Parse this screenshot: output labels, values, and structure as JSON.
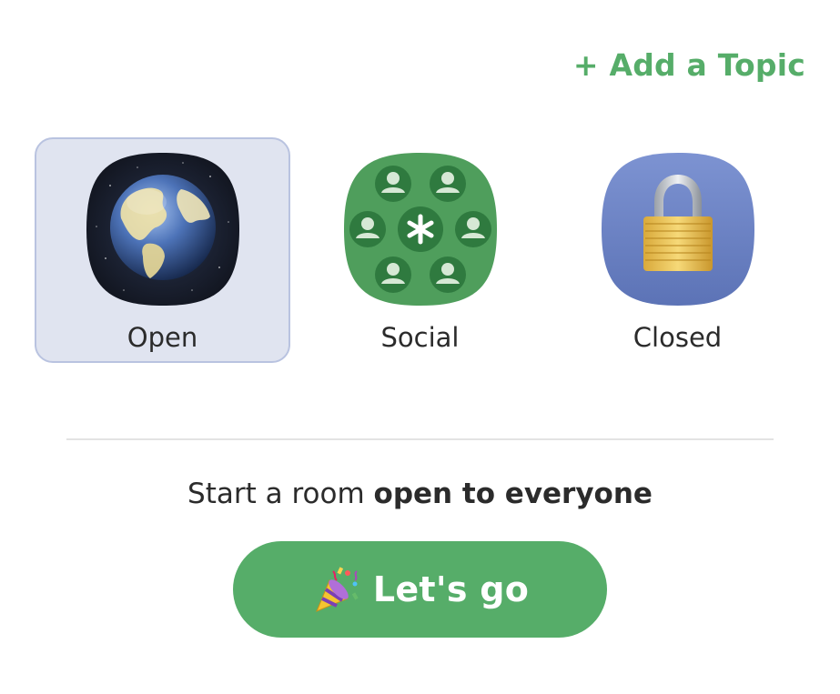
{
  "header": {
    "add_topic_label": "+ Add a Topic"
  },
  "room_types": [
    {
      "label": "Open",
      "icon": "globe-icon",
      "selected": true
    },
    {
      "label": "Social",
      "icon": "social-group-icon",
      "selected": false
    },
    {
      "label": "Closed",
      "icon": "padlock-icon",
      "selected": false
    }
  ],
  "description": {
    "prefix": "Start a room ",
    "emphasis": "open to everyone"
  },
  "action": {
    "emoji": "party-popper-icon",
    "label": "Let's go"
  },
  "colors": {
    "accent": "#56ad69",
    "selected_bg": "#e0e4f0",
    "selected_border": "#b9c3e0"
  }
}
